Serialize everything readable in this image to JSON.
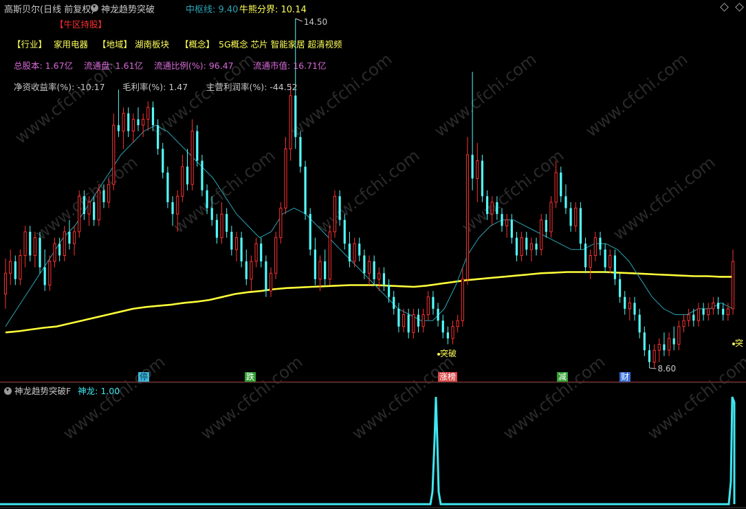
{
  "header": {
    "symbol": "高斯贝尔(日线 前复权)",
    "indicator": "神龙趋势突破",
    "pivot_label": "中枢线: 9.40",
    "bullbear_label": "牛熊分界: 10.14"
  },
  "tag": "【牛区持股】",
  "info": {
    "industry_key": "【行业】",
    "industry": "家用电器",
    "region_key": "【地域】",
    "region": "湖南板块",
    "concept_key": "【概念】",
    "concepts": "5G概念 芯片 智能家居 超清视频",
    "total_shares": "总股本: 1.67亿",
    "float_shares": "流通盘: 1.61亿",
    "float_ratio": "流通比例(%): 96.47",
    "float_mv": "流通市值: 16.71亿",
    "roe": "净资收益率(%): -10.17",
    "gross_margin": "毛利率(%): 1.47",
    "op_margin": "主营利润率(%): -44.52"
  },
  "annotations": {
    "high": "14.50",
    "low": "8.60",
    "breakout": "突破",
    "breakout_right": "突"
  },
  "events": [
    {
      "label": "停",
      "color": "#3fb7d8"
    },
    {
      "label": "跌",
      "color": "#33a033"
    },
    {
      "label": "涨榜",
      "color": "#d94a4a"
    },
    {
      "label": "减",
      "color": "#33a033"
    },
    {
      "label": "财",
      "color": "#3a6fd8"
    }
  ],
  "lower": {
    "title": "神龙趋势突破F",
    "value_label": "神龙: 1.00"
  },
  "watermark": "www.cfchi.com",
  "colors": {
    "up": "#ff3232",
    "down": "#54fcfc",
    "ma": "#2aa5b5",
    "bullbear": "#ffff3a",
    "spike": "#3ee6f0",
    "pink": "#d86ad8",
    "yellow": "#ffff5a",
    "tag": "#ff3030"
  },
  "chart_data": {
    "type": "candlestick",
    "price_range": [
      8.6,
      14.5
    ],
    "ohlc": [
      [
        9.85,
        10.45,
        9.6,
        10.2
      ],
      [
        10.2,
        10.6,
        10.0,
        10.4
      ],
      [
        10.4,
        10.5,
        10.0,
        10.1
      ],
      [
        10.1,
        10.6,
        10.0,
        10.5
      ],
      [
        10.5,
        11.0,
        10.3,
        10.9
      ],
      [
        10.9,
        11.0,
        10.4,
        10.5
      ],
      [
        10.5,
        10.9,
        10.3,
        10.8
      ],
      [
        10.8,
        10.9,
        10.2,
        10.3
      ],
      [
        10.3,
        10.6,
        9.9,
        10.0
      ],
      [
        10.0,
        10.5,
        9.9,
        10.4
      ],
      [
        10.4,
        10.8,
        10.3,
        10.7
      ],
      [
        10.7,
        10.8,
        10.4,
        10.5
      ],
      [
        10.5,
        11.0,
        10.4,
        10.9
      ],
      [
        10.9,
        11.1,
        10.6,
        10.7
      ],
      [
        10.7,
        11.0,
        10.5,
        10.9
      ],
      [
        10.9,
        11.6,
        10.8,
        11.5
      ],
      [
        11.5,
        11.6,
        11.1,
        11.2
      ],
      [
        11.2,
        11.5,
        11.0,
        11.4
      ],
      [
        11.4,
        11.5,
        11.0,
        11.1
      ],
      [
        11.1,
        11.7,
        11.0,
        11.6
      ],
      [
        11.6,
        11.7,
        11.3,
        11.4
      ],
      [
        11.4,
        11.8,
        11.3,
        11.7
      ],
      [
        11.7,
        12.9,
        11.6,
        12.7
      ],
      [
        12.7,
        13.3,
        12.5,
        12.6
      ],
      [
        12.6,
        13.0,
        12.3,
        12.9
      ],
      [
        12.9,
        13.0,
        12.5,
        12.6
      ],
      [
        12.6,
        12.9,
        12.4,
        12.8
      ],
      [
        12.8,
        13.0,
        12.6,
        12.7
      ],
      [
        12.7,
        12.9,
        12.5,
        12.8
      ],
      [
        12.8,
        13.1,
        12.6,
        13.0
      ],
      [
        13.0,
        13.1,
        12.6,
        12.7
      ],
      [
        12.7,
        12.8,
        12.2,
        12.3
      ],
      [
        12.3,
        12.4,
        11.8,
        11.9
      ],
      [
        11.9,
        12.0,
        11.3,
        11.4
      ],
      [
        11.4,
        11.5,
        11.0,
        11.2
      ],
      [
        11.2,
        11.6,
        10.9,
        11.5
      ],
      [
        11.5,
        12.2,
        11.4,
        12.0
      ],
      [
        12.0,
        12.3,
        11.6,
        11.7
      ],
      [
        11.7,
        12.8,
        11.6,
        12.6
      ],
      [
        12.6,
        12.7,
        12.0,
        12.1
      ],
      [
        12.1,
        12.2,
        11.5,
        11.6
      ],
      [
        11.6,
        11.7,
        11.2,
        11.3
      ],
      [
        11.3,
        11.5,
        11.0,
        11.1
      ],
      [
        11.1,
        11.2,
        10.7,
        10.8
      ],
      [
        10.8,
        11.4,
        10.7,
        11.2
      ],
      [
        11.2,
        11.3,
        10.8,
        10.9
      ],
      [
        10.9,
        11.0,
        10.5,
        10.6
      ],
      [
        10.6,
        10.9,
        10.4,
        10.8
      ],
      [
        10.8,
        10.9,
        10.3,
        10.4
      ],
      [
        10.4,
        10.6,
        10.0,
        10.1
      ],
      [
        10.1,
        10.5,
        9.9,
        10.4
      ],
      [
        10.4,
        10.8,
        10.3,
        10.7
      ],
      [
        10.7,
        10.8,
        10.3,
        10.4
      ],
      [
        10.4,
        10.5,
        9.8,
        9.9
      ],
      [
        9.9,
        10.3,
        9.8,
        10.2
      ],
      [
        10.2,
        10.9,
        10.1,
        10.8
      ],
      [
        10.8,
        11.4,
        10.7,
        11.3
      ],
      [
        11.3,
        12.5,
        11.2,
        12.3
      ],
      [
        12.3,
        13.4,
        12.1,
        13.2
      ],
      [
        13.2,
        14.5,
        12.3,
        12.5
      ],
      [
        12.5,
        12.6,
        11.9,
        12.0
      ],
      [
        12.0,
        12.1,
        11.1,
        11.2
      ],
      [
        11.2,
        11.3,
        10.5,
        10.6
      ],
      [
        10.6,
        10.8,
        10.0,
        10.1
      ],
      [
        10.1,
        10.5,
        9.9,
        10.4
      ],
      [
        10.4,
        10.6,
        10.0,
        10.1
      ],
      [
        10.1,
        11.0,
        10.0,
        10.9
      ],
      [
        10.9,
        11.6,
        10.8,
        11.5
      ],
      [
        11.5,
        11.6,
        11.0,
        11.1
      ],
      [
        11.1,
        11.2,
        10.6,
        10.7
      ],
      [
        10.7,
        10.9,
        10.3,
        10.4
      ],
      [
        10.4,
        10.8,
        10.3,
        10.7
      ],
      [
        10.7,
        10.8,
        10.4,
        10.5
      ],
      [
        10.5,
        10.6,
        10.1,
        10.2
      ],
      [
        10.2,
        10.5,
        10.0,
        10.4
      ],
      [
        10.4,
        10.5,
        10.0,
        10.1
      ],
      [
        10.1,
        10.3,
        9.9,
        10.2
      ],
      [
        10.2,
        10.3,
        9.9,
        10.0
      ],
      [
        10.0,
        10.1,
        9.7,
        9.8
      ],
      [
        9.8,
        9.9,
        9.5,
        9.6
      ],
      [
        9.6,
        9.7,
        9.2,
        9.3
      ],
      [
        9.3,
        9.6,
        9.2,
        9.5
      ],
      [
        9.5,
        9.6,
        9.1,
        9.2
      ],
      [
        9.2,
        9.6,
        9.1,
        9.5
      ],
      [
        9.5,
        9.6,
        9.2,
        9.3
      ],
      [
        9.3,
        9.6,
        9.2,
        9.5
      ],
      [
        9.5,
        9.9,
        9.4,
        9.8
      ],
      [
        9.8,
        9.9,
        9.5,
        9.6
      ],
      [
        9.6,
        9.7,
        9.3,
        9.4
      ],
      [
        9.4,
        9.5,
        9.1,
        9.2
      ],
      [
        9.2,
        9.3,
        9.0,
        9.1
      ],
      [
        9.1,
        9.4,
        9.0,
        9.3
      ],
      [
        9.3,
        9.5,
        9.2,
        9.4
      ],
      [
        9.4,
        10.3,
        9.3,
        10.1
      ],
      [
        10.1,
        12.5,
        10.0,
        12.2
      ],
      [
        12.2,
        13.6,
        11.6,
        11.8
      ],
      [
        11.8,
        12.4,
        11.4,
        12.1
      ],
      [
        12.1,
        12.2,
        11.4,
        11.5
      ],
      [
        11.5,
        11.6,
        11.1,
        11.2
      ],
      [
        11.2,
        11.5,
        11.0,
        11.4
      ],
      [
        11.4,
        11.5,
        11.1,
        11.2
      ],
      [
        11.2,
        11.3,
        10.9,
        11.0
      ],
      [
        11.0,
        11.2,
        10.8,
        11.1
      ],
      [
        11.1,
        11.2,
        10.7,
        10.8
      ],
      [
        10.8,
        10.9,
        10.4,
        10.5
      ],
      [
        10.5,
        10.9,
        10.4,
        10.8
      ],
      [
        10.8,
        10.9,
        10.5,
        10.6
      ],
      [
        10.6,
        10.8,
        10.4,
        10.7
      ],
      [
        10.7,
        10.8,
        10.5,
        10.6
      ],
      [
        10.6,
        11.2,
        10.5,
        11.1
      ],
      [
        11.1,
        11.2,
        10.8,
        10.9
      ],
      [
        10.9,
        11.5,
        10.8,
        11.4
      ],
      [
        11.4,
        12.1,
        11.3,
        11.9
      ],
      [
        11.9,
        12.0,
        11.4,
        11.5
      ],
      [
        11.5,
        11.7,
        11.2,
        11.3
      ],
      [
        11.3,
        11.4,
        10.9,
        11.0
      ],
      [
        11.0,
        11.4,
        10.9,
        11.3
      ],
      [
        11.3,
        11.4,
        10.6,
        10.7
      ],
      [
        10.7,
        10.8,
        10.2,
        10.3
      ],
      [
        10.3,
        10.6,
        10.1,
        10.5
      ],
      [
        10.5,
        10.9,
        10.4,
        10.8
      ],
      [
        10.8,
        10.9,
        10.5,
        10.6
      ],
      [
        10.6,
        10.7,
        10.2,
        10.3
      ],
      [
        10.3,
        10.6,
        10.2,
        10.5
      ],
      [
        10.5,
        10.6,
        10.0,
        10.1
      ],
      [
        10.1,
        10.2,
        9.7,
        9.8
      ],
      [
        9.8,
        9.9,
        9.5,
        9.6
      ],
      [
        9.6,
        9.8,
        9.4,
        9.7
      ],
      [
        9.7,
        9.8,
        9.4,
        9.5
      ],
      [
        9.5,
        9.6,
        9.1,
        9.2
      ],
      [
        9.2,
        9.3,
        8.8,
        8.9
      ],
      [
        8.9,
        9.0,
        8.6,
        8.7
      ],
      [
        8.7,
        9.0,
        8.6,
        8.9
      ],
      [
        8.9,
        9.1,
        8.7,
        9.0
      ],
      [
        9.0,
        9.2,
        8.8,
        8.9
      ],
      [
        8.9,
        9.2,
        8.8,
        9.1
      ],
      [
        9.1,
        9.3,
        8.9,
        9.0
      ],
      [
        9.0,
        9.4,
        8.9,
        9.3
      ],
      [
        9.3,
        9.5,
        9.2,
        9.4
      ],
      [
        9.4,
        9.6,
        9.3,
        9.5
      ],
      [
        9.5,
        9.6,
        9.3,
        9.4
      ],
      [
        9.4,
        9.7,
        9.3,
        9.6
      ],
      [
        9.6,
        9.7,
        9.4,
        9.5
      ],
      [
        9.5,
        9.7,
        9.4,
        9.6
      ],
      [
        9.6,
        9.8,
        9.5,
        9.7
      ],
      [
        9.7,
        9.8,
        9.5,
        9.6
      ],
      [
        9.6,
        9.7,
        9.4,
        9.5
      ],
      [
        9.5,
        9.7,
        9.4,
        9.6
      ],
      [
        9.6,
        10.6,
        9.5,
        10.4
      ]
    ],
    "ma_teal": [
      9.3,
      9.6,
      9.9,
      10.2,
      10.5,
      10.8,
      11.0,
      11.3,
      11.6,
      11.9,
      12.2,
      12.4,
      12.6,
      12.7,
      12.6,
      12.4,
      12.2,
      12.0,
      11.8,
      11.5,
      11.2,
      11.0,
      10.8,
      10.9,
      11.2,
      11.3,
      11.2,
      11.0,
      10.8,
      10.6,
      10.4,
      10.2,
      10.0,
      9.8,
      9.6,
      9.5,
      9.4,
      9.4,
      9.6,
      10.0,
      10.5,
      10.8,
      11.0,
      11.1,
      11.1,
      11.0,
      10.9,
      10.8,
      10.7,
      10.6,
      10.6,
      10.7,
      10.7,
      10.6,
      10.4,
      10.1,
      9.8,
      9.6,
      9.5,
      9.5,
      9.6,
      9.6,
      9.7,
      9.6
    ],
    "bullbear": [
      9.2,
      9.22,
      9.25,
      9.28,
      9.3,
      9.35,
      9.4,
      9.45,
      9.5,
      9.55,
      9.6,
      9.63,
      9.65,
      9.67,
      9.7,
      9.72,
      9.75,
      9.8,
      9.85,
      9.88,
      9.9,
      9.93,
      9.95,
      9.96,
      9.97,
      9.98,
      9.99,
      10.0,
      10.0,
      10.0,
      9.99,
      9.98,
      9.97,
      9.99,
      10.02,
      10.05,
      10.08,
      10.1,
      10.12,
      10.14,
      10.16,
      10.18,
      10.2,
      10.21,
      10.22,
      10.22,
      10.22,
      10.22,
      10.21,
      10.2,
      10.19,
      10.18,
      10.17,
      10.16,
      10.15,
      10.15,
      10.14,
      10.14
    ]
  }
}
